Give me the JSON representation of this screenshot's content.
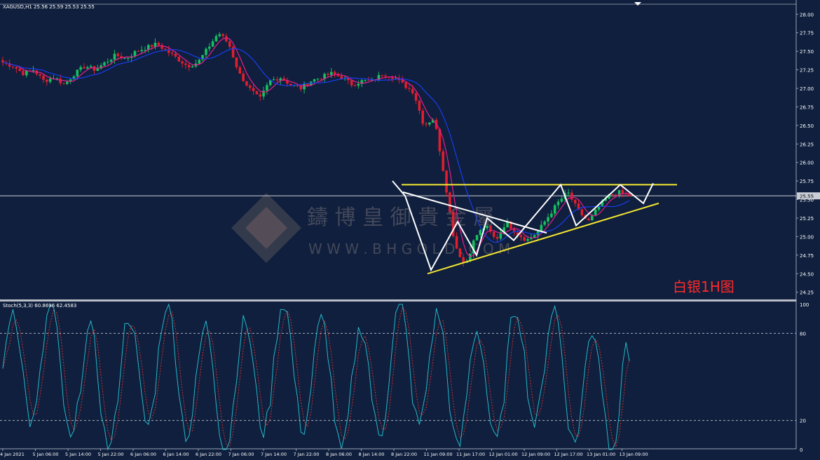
{
  "header": {
    "symbol_info": "XAGUSD,H1  25.56 25.59 25.53 25.55"
  },
  "colors": {
    "background": "#0f1f3d",
    "bull": "#16c060",
    "bear": "#e01e2e",
    "ma_fast": "#e91e8c",
    "ma_slow": "#1a3df0",
    "trend_white": "#ffffff",
    "trend_yellow": "#f5e631",
    "stoch_main": "#25b8c9",
    "stoch_signal": "#d03030",
    "annotation": "#ff2a2a"
  },
  "price_axis": {
    "ticks": [
      "28.00",
      "27.75",
      "27.50",
      "27.25",
      "27.00",
      "26.75",
      "26.50",
      "26.25",
      "26.00",
      "25.75",
      "25.55",
      "25.50",
      "25.25",
      "25.00",
      "24.75",
      "24.50",
      "24.25"
    ],
    "current_price": "25.55"
  },
  "stoch_axis": {
    "ticks": [
      "100",
      "80",
      "20",
      "0"
    ]
  },
  "stoch_label": "Stoch(5,3,3) 60.8696 62.4583",
  "time_axis": {
    "labels": [
      "4 Jan 2021",
      "5 Jan 06:00",
      "5 Jan 14:00",
      "5 Jan 22:00",
      "6 Jan 06:00",
      "6 Jan 14:00",
      "6 Jan 22:00",
      "7 Jan 06:00",
      "7 Jan 14:00",
      "7 Jan 22:00",
      "8 Jan 06:00",
      "8 Jan 14:00",
      "8 Jan 22:00",
      "11 Jan 09:00",
      "11 Jan 17:00",
      "12 Jan 01:00",
      "12 Jan 09:00",
      "12 Jan 17:00",
      "13 Jan 01:00",
      "13 Jan 09:00"
    ]
  },
  "annotation": "白银1H图",
  "watermark": {
    "brand": "鑄 博 皇 御 貴 金 屬",
    "url": "W W W . B H G O L D . C O M"
  },
  "chart_data": {
    "type": "candlestick",
    "title": "XAGUSD,H1",
    "ylim": [
      24.2,
      28.05
    ],
    "resistance_level": 25.7,
    "series": [
      {
        "name": "XAGUSD,H1",
        "close_path": [
          27.35,
          27.3,
          27.2,
          27.25,
          27.1,
          27.15,
          27.05,
          27.2,
          27.3,
          27.25,
          27.35,
          27.45,
          27.4,
          27.5,
          27.55,
          27.6,
          27.5,
          27.4,
          27.3,
          27.35,
          27.55,
          27.75,
          27.6,
          27.2,
          27.0,
          26.85,
          27.1,
          27.15,
          27.05,
          27.0,
          27.1,
          27.15,
          27.2,
          27.15,
          27.05,
          27.1,
          27.1,
          27.2,
          27.15,
          27.05,
          26.95,
          26.5,
          26.6,
          25.8,
          24.9,
          24.6,
          25.0,
          25.15,
          24.95,
          25.2,
          25.05,
          24.95,
          25.05,
          25.25,
          25.45,
          25.6,
          25.35,
          25.2,
          25.4,
          25.55,
          25.6,
          25.55
        ]
      },
      {
        "name": "MA fast"
      },
      {
        "name": "MA slow"
      }
    ],
    "stochastic": {
      "name": "Stoch(5,3,3)",
      "main": 60.8696,
      "signal": 62.4583,
      "levels": [
        80,
        20
      ],
      "ylim": [
        0,
        100
      ]
    }
  }
}
